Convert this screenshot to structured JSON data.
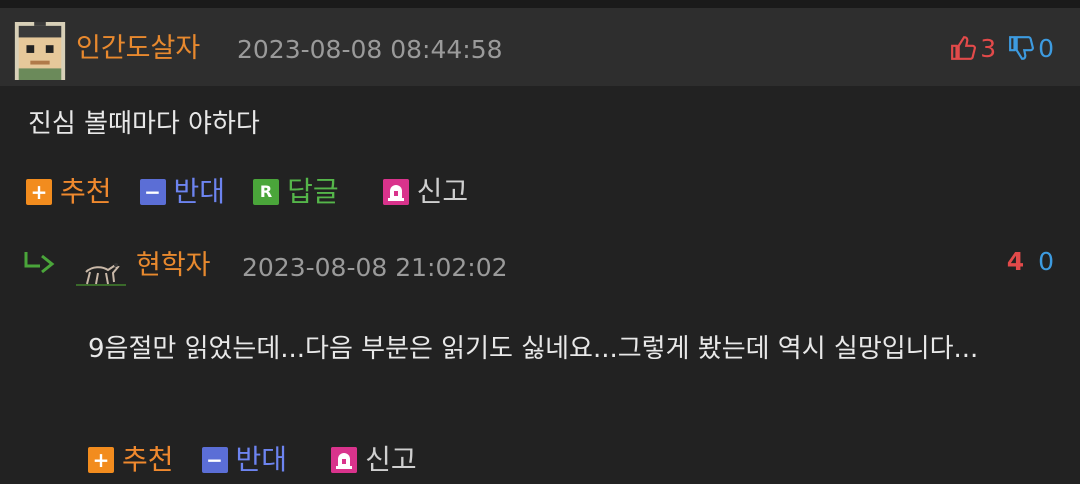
{
  "comment": {
    "nickname": "인간도살자",
    "date": "2023-08-08 08:44:58",
    "likes": "3",
    "dislikes": "0",
    "text": "진심 볼때마다 야하다",
    "actions": {
      "recommend": "추천",
      "oppose": "반대",
      "reply": "답글",
      "report": "신고",
      "reply_badge": "R"
    }
  },
  "reply": {
    "nickname": "현학자",
    "date": "2023-08-08 21:02:02",
    "likes": "4",
    "dislikes": "0",
    "text": "9음절만 읽었는데...다음 부분은 읽기도 싫네요...그렇게 봤는데 역시 실망입니다...",
    "actions": {
      "recommend": "추천",
      "oppose": "반대",
      "report": "신고"
    }
  },
  "colors": {
    "background": "#222222",
    "header": "#2e2e2e",
    "nickname": "#e8892e",
    "like": "#e24a4a",
    "dislike": "#3d9be0"
  },
  "icons": [
    "avatar-pixel-icon",
    "thumbs-up-icon",
    "thumbs-down-icon",
    "plus-icon",
    "minus-icon",
    "reply-badge-icon",
    "siren-icon",
    "reply-arrow-icon"
  ]
}
